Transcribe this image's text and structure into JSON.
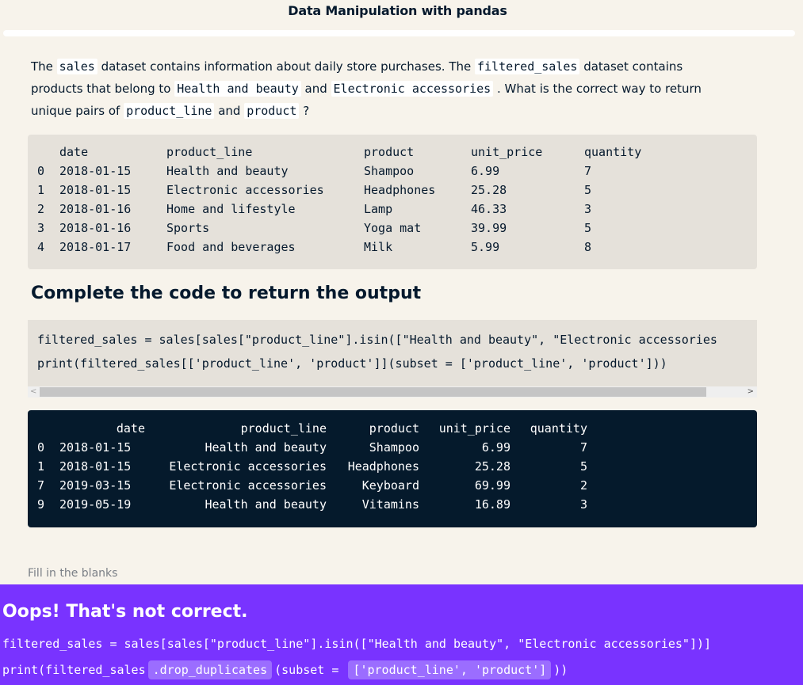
{
  "header": {
    "title": "Data Manipulation with pandas"
  },
  "question": {
    "p1": "The ",
    "c1": "sales",
    "p2": " dataset contains information about daily store purchases. The ",
    "c2": "filtered_sales",
    "p3": " dataset contains products that belong to ",
    "c3": "Health and beauty",
    "p4": " and ",
    "c4": "Electronic accessories",
    "p5": " . What is the correct way to return unique pairs of ",
    "c5": "product_line",
    "p6": " and ",
    "c6": "product",
    "p7": " ?"
  },
  "table": {
    "headers": [
      "date",
      "product_line",
      "product",
      "unit_price",
      "quantity"
    ],
    "rows": [
      {
        "idx": "0",
        "date": "2018-01-15",
        "product_line": "Health and beauty",
        "product": "Shampoo",
        "unit_price": "6.99",
        "quantity": "7"
      },
      {
        "idx": "1",
        "date": "2018-01-15",
        "product_line": "Electronic accessories",
        "product": "Headphones",
        "unit_price": "25.28",
        "quantity": "5"
      },
      {
        "idx": "2",
        "date": "2018-01-16",
        "product_line": "Home and lifestyle",
        "product": "Lamp",
        "unit_price": "46.33",
        "quantity": "3"
      },
      {
        "idx": "3",
        "date": "2018-01-16",
        "product_line": "Sports",
        "product": "Yoga mat",
        "unit_price": "39.99",
        "quantity": "5"
      },
      {
        "idx": "4",
        "date": "2018-01-17",
        "product_line": "Food and beverages",
        "product": "Milk",
        "unit_price": "5.99",
        "quantity": "8"
      }
    ]
  },
  "section": {
    "heading": "Complete the code to return the output"
  },
  "code": {
    "line1": "filtered_sales = sales[sales[\"product_line\"].isin([\"Health and beauty\", \"Electronic accessories",
    "line2": "print(filtered_sales[['product_line', 'product']](subset = ['product_line', 'product']))"
  },
  "scrollbar": {
    "left_arrow": "<",
    "right_arrow": ">"
  },
  "output": {
    "headers": [
      "date",
      "product_line",
      "product",
      "unit_price",
      "quantity"
    ],
    "rows": [
      {
        "idx": "0",
        "date": "2018-01-15",
        "product_line": "Health and beauty",
        "product": "Shampoo",
        "unit_price": "6.99",
        "quantity": "7"
      },
      {
        "idx": "1",
        "date": "2018-01-15",
        "product_line": "Electronic accessories",
        "product": "Headphones",
        "unit_price": "25.28",
        "quantity": "5"
      },
      {
        "idx": "7",
        "date": "2019-03-15",
        "product_line": "Electronic accessories",
        "product": "Keyboard",
        "unit_price": "69.99",
        "quantity": "2"
      },
      {
        "idx": "9",
        "date": "2019-05-19",
        "product_line": "Health and beauty",
        "product": "Vitamins",
        "unit_price": "16.89",
        "quantity": "3"
      }
    ]
  },
  "fill_label": "Fill in the blanks",
  "feedback": {
    "title": "Oops! That's not correct.",
    "line1": "filtered_sales = sales[sales[\"product_line\"].isin([\"Health and beauty\", \"Electronic accessories\"])]",
    "line2_prefix": "print(filtered_sales",
    "blank1": ".drop_duplicates",
    "line2_mid": "(subset = ",
    "blank2": "['product_line', 'product']",
    "line2_suffix": "))"
  },
  "colors": {
    "background": "#f7f3eb",
    "code_bg": "#e5e1da",
    "output_bg": "#051a2c",
    "feedback_bg": "#7933ff",
    "blank_bg": "#9b6dff"
  }
}
